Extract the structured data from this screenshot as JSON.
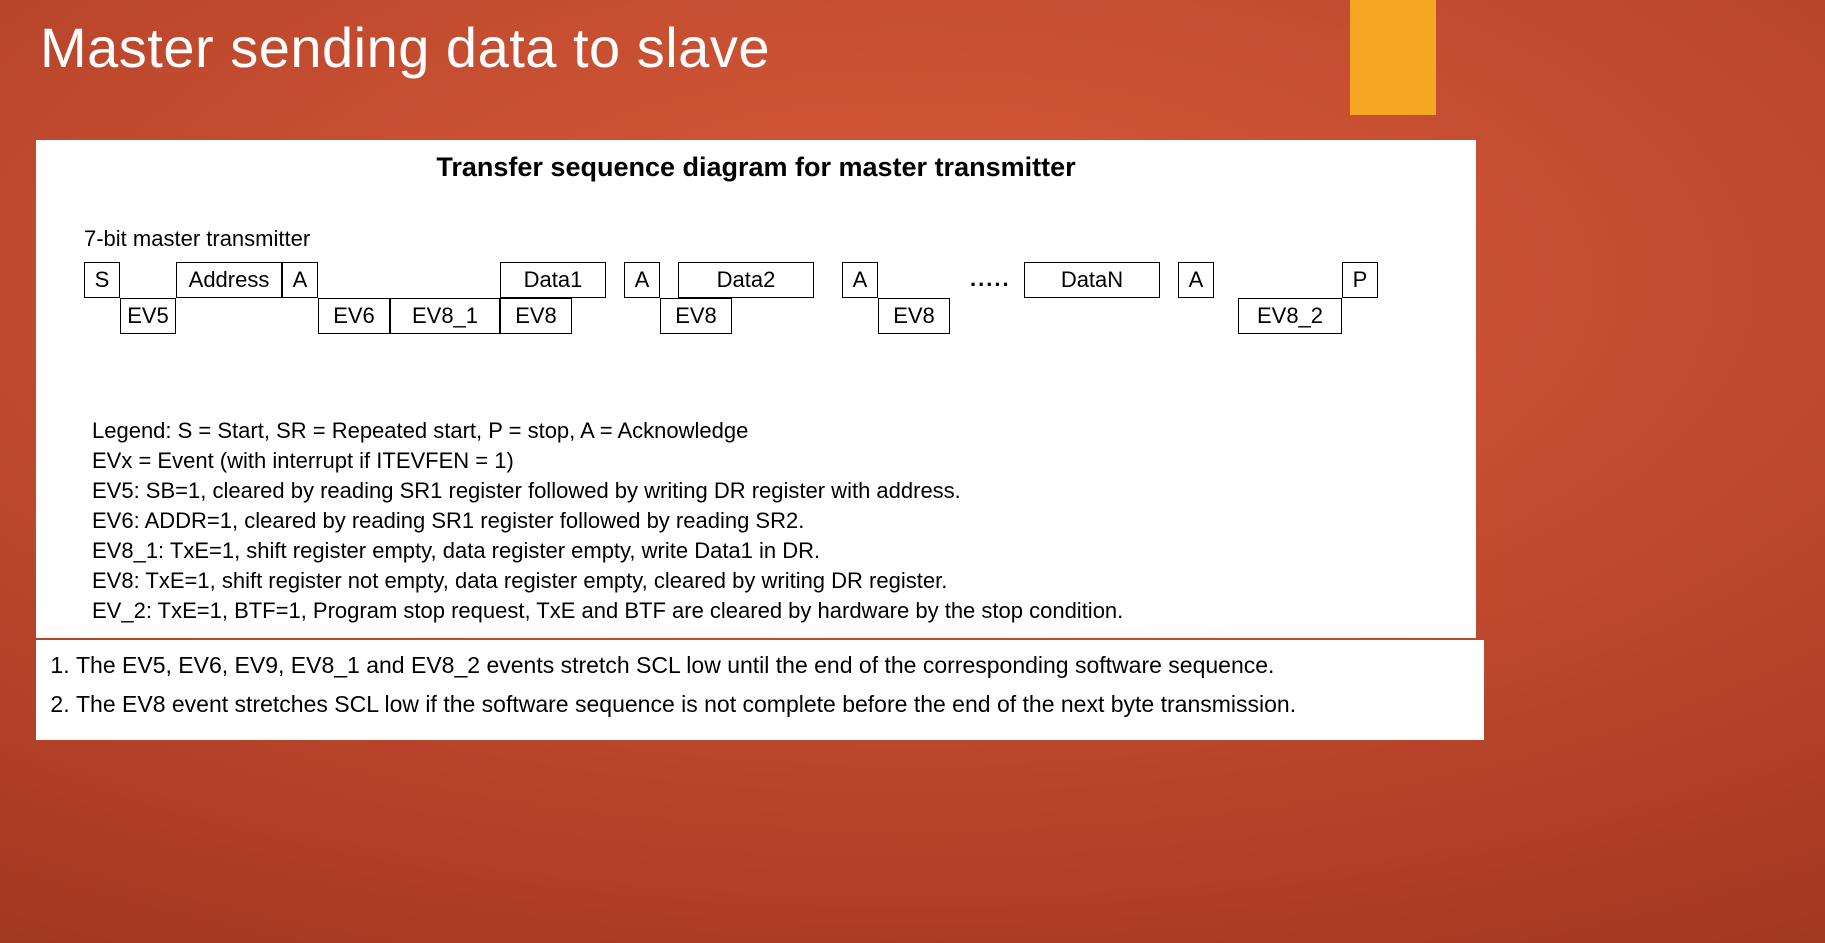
{
  "title": "Master sending data to slave",
  "panel": {
    "heading": "Transfer sequence diagram for master transmitter",
    "subheading": "7-bit master transmitter"
  },
  "seq": {
    "top": {
      "s": "S",
      "addr": "Address",
      "a1": "A",
      "d1": "Data1",
      "a2": "A",
      "d2": "Data2",
      "a3": "A",
      "dn": "DataN",
      "an": "A",
      "p": "P"
    },
    "bot": {
      "ev5": "EV5",
      "ev6": "EV6",
      "ev81": "EV8_1",
      "ev8a": "EV8",
      "ev8b": "EV8",
      "ev8c": "EV8",
      "ev82": "EV8_2"
    },
    "ellipsis": "....."
  },
  "legend": {
    "l1": "Legend: S = Start, SR = Repeated start, P = stop, A = Acknowledge",
    "l2": "EVx = Event (with interrupt if ITEVFEN = 1)",
    "l3": "EV5: SB=1, cleared by reading SR1 register followed by writing DR register with address.",
    "l4": "EV6: ADDR=1, cleared by reading SR1 register followed by reading SR2.",
    "l5": "EV8_1: TxE=1, shift register empty, data register empty, write Data1 in DR.",
    "l6": "EV8: TxE=1, shift register not empty, data register empty, cleared by writing DR register.",
    "l7": "EV_2: TxE=1, BTF=1, Program stop request, TxE and BTF are cleared by hardware by the stop condition."
  },
  "notes": {
    "n1": "The EV5, EV6, EV9, EV8_1 and EV8_2 events stretch SCL low until the end of the corresponding software sequence.",
    "n2": "The EV8 event stretches SCL low if the software sequence is not complete before the end of the next byte transmission."
  }
}
